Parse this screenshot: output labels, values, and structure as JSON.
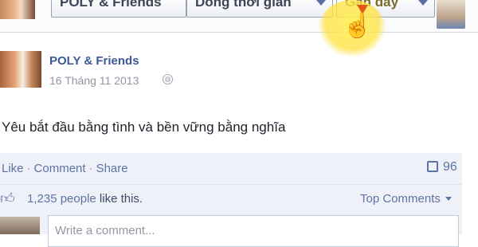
{
  "top": {
    "filter_page_label": "POLY & Friends",
    "filter_time_label": "Dòng thời gian",
    "filter_sort_label": "Gần đây"
  },
  "post": {
    "author": "POLY & Friends",
    "date": "16 Tháng 11 2013",
    "message": "Yêu bắt đầu bằng tình và bền vững bằng nghĩa"
  },
  "actions": {
    "like": "Like",
    "comment": "Comment",
    "share": "Share",
    "comment_count": "96"
  },
  "likes": {
    "count": "1,235 people",
    "suffix": " like this."
  },
  "comments": {
    "sort_label": "Top Comments",
    "input_placeholder": "Write a comment..."
  },
  "colors": {
    "link": "#3b5998",
    "footer_bg": "#eef1f7",
    "cursor_highlight": "#ffe13c"
  },
  "icons": [
    "globe-icon",
    "like-thumb-icon",
    "comment-bubble-icon",
    "hand-cursor-icon",
    "dropdown-arrow-icon"
  ]
}
